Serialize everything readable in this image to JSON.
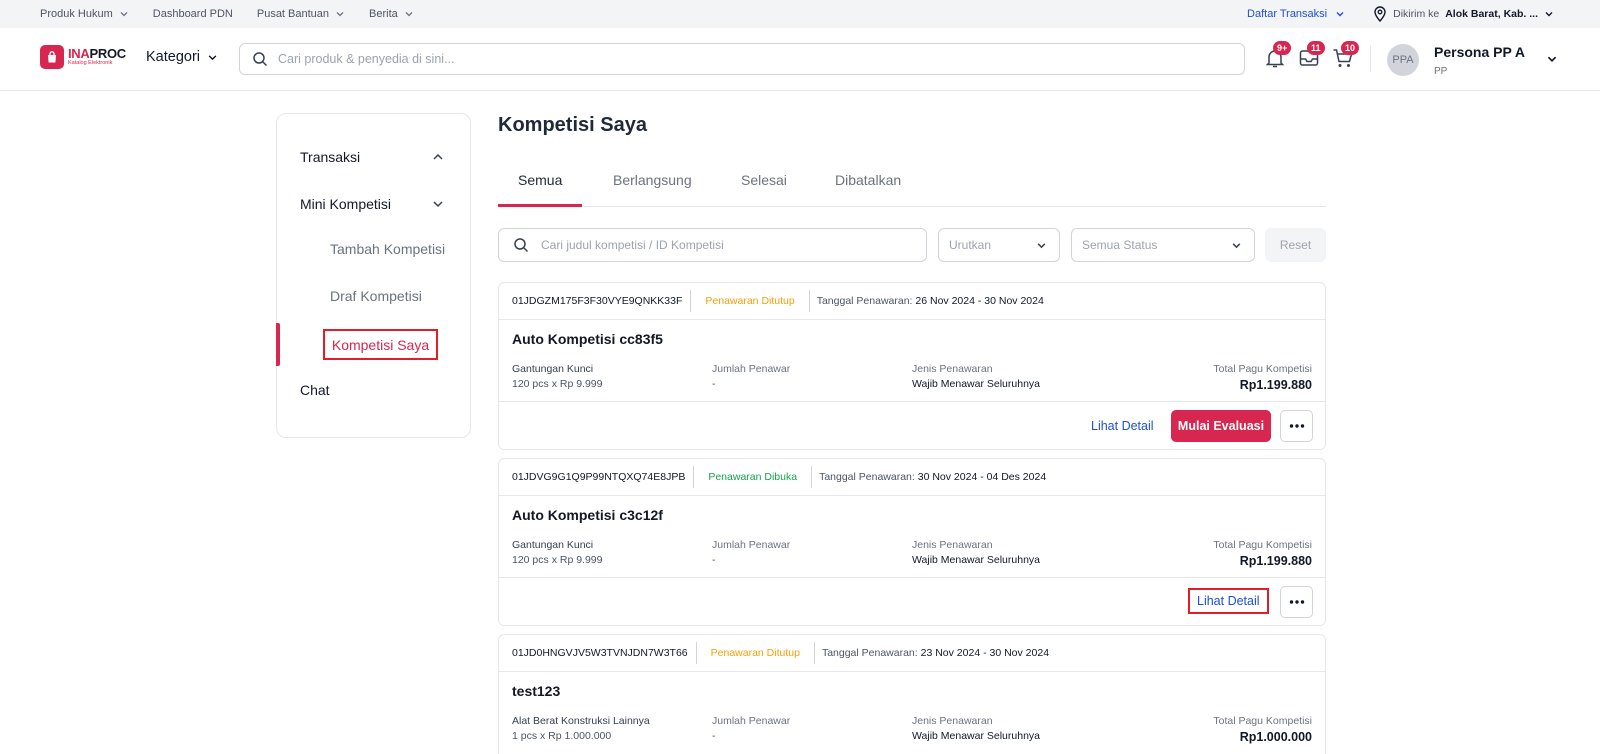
{
  "topbar": {
    "links": [
      "Produk Hukum",
      "Dashboard PDN",
      "Pusat Bantuan",
      "Berita"
    ],
    "daftar_transaksi": "Daftar Transaksi",
    "ship_label": "Dikirim ke",
    "ship_value": "Alok Barat, Kab. ..."
  },
  "header": {
    "logo_title_a": "INA",
    "logo_title_b": "PROC",
    "logo_sub": "Katalog Elektronik",
    "kategori": "Kategori",
    "search_placeholder": "Cari produk & penyedia di sini...",
    "badges": {
      "notif": "9+",
      "inbox": "11",
      "cart": "10"
    },
    "avatar": "PPA",
    "user_name": "Persona PP A",
    "user_role": "PP"
  },
  "sidebar": {
    "transaksi": "Transaksi",
    "mini_kompetisi": "Mini Kompetisi",
    "tambah": "Tambah Kompetisi",
    "draf": "Draf Kompetisi",
    "kompetisi_saya": "Kompetisi Saya",
    "chat": "Chat"
  },
  "main": {
    "title": "Kompetisi Saya",
    "tabs": [
      "Semua",
      "Berlangsung",
      "Selesai",
      "Dibatalkan"
    ],
    "filter_placeholder": "Cari judul kompetisi / ID Kompetisi",
    "sort_label": "Urutkan",
    "status_label": "Semua Status",
    "reset_label": "Reset",
    "cards": [
      {
        "id": "01JDGZM175F3F30VYE9QNKK33F",
        "status": "Penawaran Ditutup",
        "date_label": "Tanggal Penawaran:",
        "date_value": "26 Nov 2024 - 30 Nov 2024",
        "title": "Auto Kompetisi cc83f5",
        "product": "Gantungan Kunci",
        "qty": "120 pcs x Rp 9.999",
        "penawar_label": "Jumlah Penawar",
        "penawar_value": "-",
        "jenis_label": "Jenis Penawaran",
        "jenis_value": "Wajib Menawar Seluruhnya",
        "total_label": "Total Pagu Kompetisi",
        "total_value": "Rp1.199.880",
        "lihat": "Lihat Detail",
        "mulai": "Mulai Evaluasi"
      },
      {
        "id": "01JDVG9G1Q9P99NTQXQ74E8JPB",
        "status": "Penawaran Dibuka",
        "date_label": "Tanggal Penawaran:",
        "date_value": "30 Nov 2024 - 04 Des 2024",
        "title": "Auto Kompetisi c3c12f",
        "product": "Gantungan Kunci",
        "qty": "120 pcs x Rp 9.999",
        "penawar_label": "Jumlah Penawar",
        "penawar_value": "-",
        "jenis_label": "Jenis Penawaran",
        "jenis_value": "Wajib Menawar Seluruhnya",
        "total_label": "Total Pagu Kompetisi",
        "total_value": "Rp1.199.880",
        "lihat": "Lihat Detail"
      },
      {
        "id": "01JD0HNGVJV5W3TVNJDN7W3T66",
        "status": "Penawaran Ditutup",
        "date_label": "Tanggal Penawaran:",
        "date_value": "23 Nov 2024 - 30 Nov 2024",
        "title": "test123",
        "product": "Alat Berat Konstruksi Lainnya",
        "qty": "1 pcs x Rp 1.000.000",
        "penawar_label": "Jumlah Penawar",
        "penawar_value": "-",
        "jenis_label": "Jenis Penawaran",
        "jenis_value": "Wajib Menawar Seluruhnya",
        "total_label": "Total Pagu Kompetisi",
        "total_value": "Rp1.000.000"
      }
    ]
  },
  "colors": {
    "brand": "#d7264f",
    "link": "#1d4ed8",
    "status_closed": "#f59e0b",
    "status_open": "#16a34a"
  }
}
